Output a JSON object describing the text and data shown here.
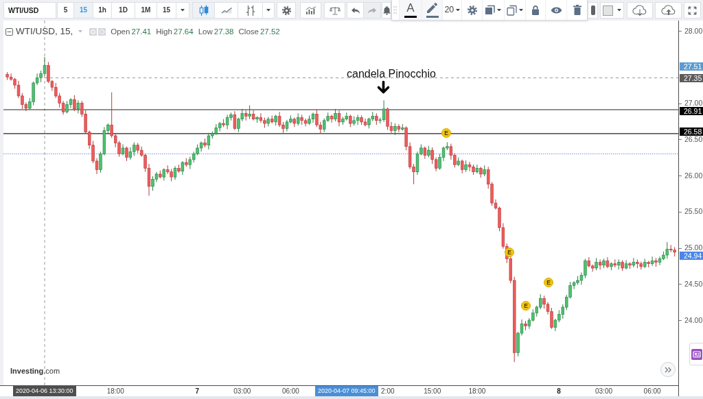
{
  "toolbar": {
    "symbol": "WTI/USD",
    "intervals": [
      {
        "label": "5",
        "selected": false
      },
      {
        "label": "15",
        "selected": true
      },
      {
        "label": "1h",
        "selected": false
      },
      {
        "label": "1D",
        "selected": false
      },
      {
        "label": "1M",
        "selected": false
      }
    ],
    "interval_menu": "15",
    "chart_types": [
      {
        "kind": "candles",
        "selected": true
      },
      {
        "kind": "line",
        "selected": false
      },
      {
        "kind": "bars",
        "selected": false
      }
    ],
    "tools": [
      {
        "kind": "settings",
        "disabled": false
      },
      {
        "kind": "indicators",
        "disabled": false
      },
      {
        "kind": "compare",
        "disabled": false
      },
      {
        "kind": "undo",
        "disabled": false
      },
      {
        "kind": "redo",
        "disabled": true
      },
      {
        "kind": "alert",
        "disabled": false
      }
    ],
    "right_tools": [
      {
        "kind": "clipped"
      },
      {
        "kind": "fill",
        "color": "#e3e3e3"
      },
      {
        "kind": "download"
      },
      {
        "kind": "upload"
      },
      {
        "kind": "fullscreen"
      }
    ]
  },
  "drawing_toolbar": {
    "items": [
      {
        "kind": "handle"
      },
      {
        "kind": "text_color",
        "label": "A",
        "color": "#000000"
      },
      {
        "kind": "line_color",
        "color": "#5d6f86"
      },
      {
        "kind": "font_size",
        "label": "20"
      },
      {
        "kind": "settings"
      },
      {
        "kind": "background"
      },
      {
        "kind": "clone"
      },
      {
        "kind": "lock"
      },
      {
        "kind": "visibility"
      },
      {
        "kind": "delete"
      }
    ]
  },
  "legend": {
    "title": "WTI/USD, 15,",
    "values": [
      {
        "label": "Open",
        "value": "27.41"
      },
      {
        "label": "High",
        "value": "27.64"
      },
      {
        "label": "Low",
        "value": "27.38"
      },
      {
        "label": "Close",
        "value": "27.52"
      }
    ]
  },
  "chart": {
    "annotation": "candela Pinocchio",
    "events": [
      {
        "label": "E"
      },
      {
        "label": "E"
      },
      {
        "label": "E"
      },
      {
        "label": "E"
      }
    ],
    "logo": "**Investing**.com",
    "chart_data": {
      "type": "candlestick",
      "ylim": [
        23.1,
        28.142
      ],
      "yticks": [
        {
          "value": 28,
          "label": "28.00"
        },
        {
          "value": 27,
          "label": "27.00"
        },
        {
          "value": 26.5,
          "label": "26.50"
        },
        {
          "value": 26,
          "label": "26.00"
        },
        {
          "value": 25.5,
          "label": "25.50"
        },
        {
          "value": 25,
          "label": "25.00"
        },
        {
          "value": 24.5,
          "label": "24.50"
        },
        {
          "value": 24,
          "label": "24.00"
        }
      ],
      "ref_lines": [
        {
          "axis": "y",
          "value": 26.91,
          "color": "#222222"
        },
        {
          "axis": "y",
          "value": 26.58,
          "color": "#222222"
        },
        {
          "axis": "y",
          "value": 26.3,
          "color": "#6b8fd8"
        }
      ],
      "categories": [
        null,
        null,
        null,
        null,
        null,
        null,
        null,
        null,
        null,
        null,
        null,
        null,
        null,
        null,
        null,
        null,
        null,
        null,
        null,
        null,
        null,
        null,
        null,
        null,
        null,
        null,
        null,
        null,
        null,
        "18:00",
        null,
        null,
        null,
        null,
        null,
        null,
        null,
        null,
        null,
        null,
        null,
        null,
        null,
        null,
        null,
        null,
        null,
        null,
        null,
        null,
        null,
        "7",
        null,
        null,
        null,
        null,
        null,
        null,
        null,
        null,
        null,
        null,
        null,
        "03:00",
        null,
        null,
        null,
        null,
        null,
        null,
        null,
        null,
        null,
        null,
        null,
        null,
        "06:00",
        null,
        null,
        null,
        null,
        null,
        null,
        null,
        null,
        null,
        null,
        null,
        null,
        null,
        null,
        null,
        null,
        null,
        null,
        null,
        null,
        null,
        null,
        null,
        null,
        null,
        "2:00",
        null,
        null,
        null,
        null,
        null,
        null,
        null,
        null,
        null,
        null,
        null,
        "15:00",
        null,
        null,
        null,
        null,
        null,
        null,
        null,
        null,
        null,
        null,
        null,
        "18:00",
        null,
        null,
        null,
        null,
        null,
        null,
        null,
        null,
        null,
        null,
        null,
        null,
        null,
        null,
        null,
        null,
        null,
        null,
        null,
        null,
        null,
        "8",
        null,
        null,
        null,
        null,
        null,
        null,
        null,
        null,
        null,
        null,
        null,
        "03:00",
        null,
        null,
        null,
        null,
        null,
        null,
        null,
        null,
        null,
        null,
        null,
        null,
        "06:00",
        null,
        null,
        null,
        null,
        null,
        null
      ],
      "ohlc": [
        [
          27.4,
          27.43,
          27.32,
          27.36
        ],
        [
          27.36,
          27.41,
          27.31,
          27.33
        ],
        [
          27.33,
          27.35,
          27.2,
          27.25
        ],
        [
          27.25,
          27.31,
          27.07,
          27.1
        ],
        [
          27.1,
          27.14,
          26.92,
          26.98
        ],
        [
          26.98,
          27.01,
          26.89,
          26.93
        ],
        [
          26.93,
          27.07,
          26.91,
          27.02
        ],
        [
          27.02,
          27.3,
          26.97,
          27.28
        ],
        [
          27.28,
          27.41,
          27.25,
          27.35
        ],
        [
          27.35,
          27.45,
          27.29,
          27.41
        ],
        [
          27.41,
          27.64,
          27.38,
          27.52
        ],
        [
          27.52,
          27.57,
          27.28,
          27.3
        ],
        [
          27.3,
          27.32,
          27.17,
          27.22
        ],
        [
          27.22,
          27.28,
          27.07,
          27.1
        ],
        [
          27.1,
          27.14,
          26.94,
          27.0
        ],
        [
          27.0,
          27.03,
          26.84,
          26.88
        ],
        [
          26.88,
          27.03,
          26.86,
          26.98
        ],
        [
          26.98,
          27.07,
          26.93,
          27.05
        ],
        [
          27.05,
          27.11,
          26.89,
          26.92
        ],
        [
          26.92,
          27.04,
          26.86,
          27.0
        ],
        [
          27.0,
          27.03,
          26.81,
          26.85
        ],
        [
          26.85,
          26.9,
          26.58,
          26.6
        ],
        [
          26.6,
          26.62,
          26.37,
          26.42
        ],
        [
          26.42,
          26.48,
          26.17,
          26.2
        ],
        [
          26.2,
          26.24,
          26.02,
          26.08
        ],
        [
          26.08,
          26.33,
          26.04,
          26.3
        ],
        [
          26.3,
          26.67,
          26.28,
          26.62
        ],
        [
          26.62,
          26.72,
          26.57,
          26.7
        ],
        [
          26.7,
          27.15,
          26.52,
          26.55
        ],
        [
          26.55,
          26.59,
          26.39,
          26.45
        ],
        [
          26.45,
          26.48,
          26.26,
          26.3
        ],
        [
          26.3,
          26.43,
          26.28,
          26.38
        ],
        [
          26.38,
          26.4,
          26.2,
          26.25
        ],
        [
          26.25,
          26.39,
          26.22,
          26.33
        ],
        [
          26.33,
          26.46,
          26.27,
          26.42
        ],
        [
          26.42,
          26.45,
          26.31,
          26.35
        ],
        [
          26.35,
          26.4,
          26.26,
          26.28
        ],
        [
          26.28,
          26.3,
          26.05,
          26.1
        ],
        [
          26.1,
          26.16,
          25.72,
          25.85
        ],
        [
          25.85,
          25.99,
          25.79,
          25.95
        ],
        [
          25.95,
          26.05,
          25.91,
          26.02
        ],
        [
          26.02,
          26.07,
          25.96,
          25.98
        ],
        [
          25.98,
          26.1,
          25.93,
          26.08
        ],
        [
          26.08,
          26.14,
          26.02,
          26.05
        ],
        [
          26.05,
          26.09,
          25.92,
          25.98
        ],
        [
          25.98,
          26.13,
          25.94,
          26.1
        ],
        [
          26.1,
          26.15,
          26.04,
          26.06
        ],
        [
          26.06,
          26.2,
          26.01,
          26.18
        ],
        [
          26.18,
          26.24,
          26.12,
          26.15
        ],
        [
          26.15,
          26.26,
          26.09,
          26.22
        ],
        [
          26.22,
          26.33,
          26.18,
          26.3
        ],
        [
          26.3,
          26.43,
          26.28,
          26.38
        ],
        [
          26.38,
          26.47,
          26.33,
          26.45
        ],
        [
          26.45,
          26.51,
          26.39,
          26.42
        ],
        [
          26.42,
          26.59,
          26.36,
          26.55
        ],
        [
          26.55,
          26.61,
          26.51,
          26.58
        ],
        [
          26.58,
          26.71,
          26.56,
          26.66
        ],
        [
          26.66,
          26.74,
          26.61,
          26.72
        ],
        [
          26.72,
          26.78,
          26.67,
          26.7
        ],
        [
          26.7,
          26.84,
          26.64,
          26.8
        ],
        [
          26.8,
          26.87,
          26.76,
          26.84
        ],
        [
          26.84,
          26.89,
          26.63,
          26.65
        ],
        [
          26.65,
          26.8,
          26.6,
          26.78
        ],
        [
          26.78,
          26.92,
          26.75,
          26.86
        ],
        [
          26.86,
          26.9,
          26.76,
          26.82
        ],
        [
          26.82,
          26.97,
          26.78,
          26.85
        ],
        [
          26.85,
          26.9,
          26.76,
          26.78
        ],
        [
          26.78,
          26.82,
          26.73,
          26.8
        ],
        [
          26.8,
          26.86,
          26.73,
          26.76
        ],
        [
          26.76,
          26.8,
          26.66,
          26.72
        ],
        [
          26.72,
          26.81,
          26.68,
          26.78
        ],
        [
          26.78,
          26.83,
          26.72,
          26.74
        ],
        [
          26.74,
          26.84,
          26.69,
          26.82
        ],
        [
          26.82,
          26.88,
          26.67,
          26.7
        ],
        [
          26.7,
          26.74,
          26.59,
          26.65
        ],
        [
          26.65,
          26.77,
          26.61,
          26.74
        ],
        [
          26.74,
          26.83,
          26.72,
          26.78
        ],
        [
          26.78,
          26.8,
          26.67,
          26.72
        ],
        [
          26.72,
          26.86,
          26.69,
          26.8
        ],
        [
          26.8,
          26.84,
          26.7,
          26.76
        ],
        [
          26.76,
          26.79,
          26.68,
          26.72
        ],
        [
          26.72,
          26.83,
          26.7,
          26.78
        ],
        [
          26.78,
          26.87,
          26.73,
          26.85
        ],
        [
          26.85,
          26.91,
          26.67,
          26.7
        ],
        [
          26.7,
          26.74,
          26.58,
          26.64
        ],
        [
          26.64,
          26.79,
          26.6,
          26.76
        ],
        [
          26.76,
          26.87,
          26.74,
          26.82
        ],
        [
          26.82,
          26.84,
          26.73,
          26.78
        ],
        [
          26.78,
          26.92,
          26.75,
          26.86
        ],
        [
          26.86,
          26.9,
          26.68,
          26.74
        ],
        [
          26.74,
          26.81,
          26.7,
          26.78
        ],
        [
          26.78,
          26.87,
          26.76,
          26.82
        ],
        [
          26.82,
          26.84,
          26.67,
          26.72
        ],
        [
          26.72,
          26.82,
          26.69,
          26.76
        ],
        [
          26.76,
          26.84,
          26.7,
          26.8
        ],
        [
          26.8,
          26.83,
          26.7,
          26.74
        ],
        [
          26.74,
          26.79,
          26.68,
          26.7
        ],
        [
          26.7,
          26.8,
          26.65,
          26.78
        ],
        [
          26.78,
          26.88,
          26.75,
          26.82
        ],
        [
          26.82,
          26.86,
          26.7,
          26.76
        ],
        [
          26.76,
          26.8,
          26.72,
          26.77
        ],
        [
          26.77,
          27.04,
          26.74,
          26.92
        ],
        [
          26.92,
          26.94,
          26.63,
          26.68
        ],
        [
          26.68,
          26.74,
          26.59,
          26.62
        ],
        [
          26.62,
          26.72,
          26.56,
          26.68
        ],
        [
          26.68,
          26.71,
          26.6,
          26.64
        ],
        [
          26.64,
          26.71,
          26.62,
          26.66
        ],
        [
          26.66,
          26.68,
          26.35,
          26.4
        ],
        [
          26.4,
          26.46,
          26.09,
          26.12
        ],
        [
          26.12,
          26.16,
          25.88,
          26.05
        ],
        [
          26.05,
          26.33,
          26.01,
          26.3
        ],
        [
          26.3,
          26.43,
          26.28,
          26.38
        ],
        [
          26.38,
          26.4,
          26.23,
          26.28
        ],
        [
          26.28,
          26.41,
          26.25,
          26.35
        ],
        [
          26.35,
          26.39,
          26.16,
          26.22
        ],
        [
          26.22,
          26.25,
          26.06,
          26.1
        ],
        [
          26.1,
          26.3,
          26.08,
          26.25
        ],
        [
          26.25,
          26.4,
          26.2,
          26.38
        ],
        [
          26.38,
          26.46,
          26.35,
          26.4
        ],
        [
          26.4,
          26.44,
          26.22,
          26.28
        ],
        [
          26.28,
          26.31,
          26.11,
          26.15
        ],
        [
          26.15,
          26.25,
          26.13,
          26.2
        ],
        [
          26.2,
          26.22,
          26.03,
          26.08
        ],
        [
          26.08,
          26.21,
          26.05,
          26.15
        ],
        [
          26.15,
          26.19,
          26.06,
          26.12
        ],
        [
          26.12,
          26.15,
          26.01,
          26.05
        ],
        [
          26.05,
          26.15,
          26.03,
          26.1
        ],
        [
          26.1,
          26.12,
          25.97,
          26.02
        ],
        [
          26.02,
          26.14,
          25.99,
          26.08
        ],
        [
          26.08,
          26.12,
          25.82,
          25.88
        ],
        [
          25.88,
          25.91,
          25.58,
          25.62
        ],
        [
          25.62,
          25.67,
          25.53,
          25.55
        ],
        [
          25.55,
          25.57,
          25.23,
          25.28
        ],
        [
          25.28,
          25.34,
          24.99,
          25.02
        ],
        [
          25.02,
          25.06,
          24.79,
          24.85
        ],
        [
          24.85,
          24.88,
          24.51,
          24.55
        ],
        [
          24.55,
          24.6,
          23.42,
          23.55
        ],
        [
          23.55,
          23.84,
          23.5,
          23.82
        ],
        [
          23.82,
          24.01,
          23.79,
          23.95
        ],
        [
          23.95,
          23.99,
          23.86,
          23.92
        ],
        [
          23.92,
          24.03,
          23.88,
          24.0
        ],
        [
          24.0,
          24.15,
          23.98,
          24.1
        ],
        [
          24.1,
          24.2,
          24.05,
          24.18
        ],
        [
          24.18,
          24.36,
          24.15,
          24.3
        ],
        [
          24.3,
          24.34,
          24.16,
          24.22
        ],
        [
          24.22,
          24.25,
          24.08,
          24.12
        ],
        [
          24.12,
          24.17,
          23.88,
          23.9
        ],
        [
          23.9,
          24.02,
          23.85,
          24.0
        ],
        [
          24.0,
          24.14,
          23.97,
          24.08
        ],
        [
          24.08,
          24.22,
          24.02,
          24.18
        ],
        [
          24.18,
          24.35,
          24.14,
          24.32
        ],
        [
          24.32,
          24.53,
          24.3,
          24.48
        ],
        [
          24.48,
          24.54,
          24.43,
          24.52
        ],
        [
          24.52,
          24.61,
          24.49,
          24.55
        ],
        [
          24.55,
          24.66,
          24.49,
          24.62
        ],
        [
          24.62,
          24.85,
          24.58,
          24.82
        ],
        [
          24.82,
          24.87,
          24.73,
          24.75
        ],
        [
          24.75,
          24.77,
          24.67,
          24.72
        ],
        [
          24.72,
          24.86,
          24.69,
          24.8
        ],
        [
          24.8,
          24.84,
          24.7,
          24.76
        ],
        [
          24.76,
          24.85,
          24.72,
          24.82
        ],
        [
          24.82,
          24.87,
          24.72,
          24.74
        ],
        [
          24.74,
          24.8,
          24.69,
          24.78
        ],
        [
          24.78,
          24.84,
          24.73,
          24.76
        ],
        [
          24.76,
          24.84,
          24.7,
          24.8
        ],
        [
          24.8,
          24.83,
          24.68,
          24.72
        ],
        [
          24.72,
          24.83,
          24.7,
          24.78
        ],
        [
          24.78,
          24.8,
          24.71,
          24.76
        ],
        [
          24.76,
          24.86,
          24.73,
          24.8
        ],
        [
          24.8,
          24.84,
          24.72,
          24.78
        ],
        [
          24.78,
          24.81,
          24.7,
          24.74
        ],
        [
          24.74,
          24.85,
          24.72,
          24.8
        ],
        [
          24.8,
          24.82,
          24.73,
          24.78
        ],
        [
          24.78,
          24.88,
          24.75,
          24.82
        ],
        [
          24.82,
          24.86,
          24.74,
          24.8
        ],
        [
          24.8,
          24.88,
          24.76,
          24.85
        ],
        [
          24.85,
          24.95,
          24.83,
          24.9
        ],
        [
          24.9,
          25.08,
          24.85,
          24.98
        ],
        [
          24.98,
          25.04,
          24.94,
          24.97
        ],
        [
          24.97,
          25.01,
          24.88,
          24.94
        ]
      ]
    }
  },
  "price_axis": {
    "labels": [
      {
        "text": "27.51",
        "kind": "bid"
      },
      {
        "text": "27.35",
        "kind": "crosshair"
      },
      {
        "text": "26.91",
        "kind": "line"
      },
      {
        "text": "26.58",
        "kind": "line"
      },
      {
        "text": "24.94",
        "kind": "last"
      }
    ]
  },
  "time_axis": {
    "ticks": [
      {
        "kind": "time"
      },
      {
        "kind": "day"
      },
      {
        "kind": "time"
      },
      {
        "kind": "time"
      },
      {
        "kind": "time"
      },
      {
        "kind": "time"
      },
      {
        "kind": "time"
      },
      {
        "kind": "day"
      },
      {
        "kind": "time"
      },
      {
        "kind": "time"
      }
    ],
    "labels": [
      {
        "text": "2020-04-06 13:30:00",
        "kind": "crosshair"
      },
      {
        "text": "2020-04-07 09:45:00",
        "kind": "selection"
      }
    ]
  }
}
